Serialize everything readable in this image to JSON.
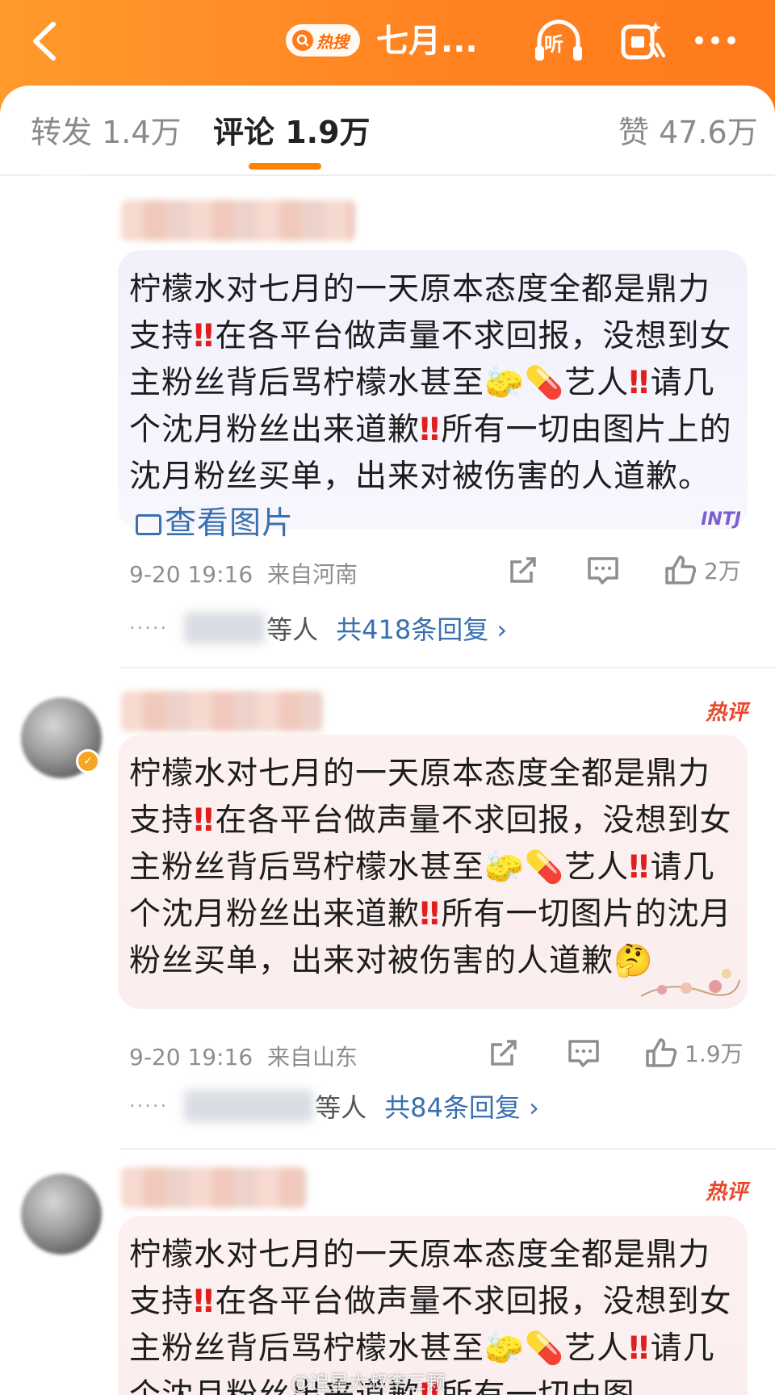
{
  "header": {
    "hot_badge": "热搜",
    "title": "七月...",
    "listen_label": "听"
  },
  "tabs": [
    {
      "label": "转发 1.4万"
    },
    {
      "label": "评论 1.9万"
    },
    {
      "label": "赞 47.6万"
    }
  ],
  "comments": [
    {
      "text_a": "柠檬水对七月的一天原本态度全都是鼎力支持",
      "text_b": "在各平台做声量不求回报，没想到女主粉丝背后骂柠檬水甚至🧽💊艺人",
      "text_c": "请几个沈月粉丝出来道歉",
      "text_d": "所有一切由图片上的沈月粉丝买单，出来对被伤害的人道歉。",
      "view_image": "查看图片",
      "bang": "‼",
      "deco": "INTJ",
      "time": "9-20 19:16",
      "location": "来自河南",
      "likes": "2万",
      "replies_suffix": "等人",
      "replies_count": "共418条回复 ›",
      "reply_dots": "·····"
    },
    {
      "hot_tag": "热评",
      "text_a": "柠檬水对七月的一天原本态度全都是鼎力支持",
      "text_b": "在各平台做声量不求回报，没想到女主粉丝背后骂柠檬水甚至🧽💊艺人",
      "text_c": "请几个沈月粉丝出来道歉",
      "text_d": "所有一切图片的沈月粉丝买单，出来对被伤害的人道歉🤔",
      "bang": "‼",
      "time": "9-20 19:16",
      "location": "来自山东",
      "likes": "1.9万",
      "replies_suffix": "等人",
      "replies_count": "共84条回复 ›",
      "reply_dots": "·····"
    },
    {
      "hot_tag": "热评",
      "text_a": "柠檬水对七月的一天原本态度全都是鼎力支持",
      "text_b": "在各平台做声量不求回报，没想到女主粉丝背后骂柠檬水甚至🧽💊艺人",
      "text_c": "请几个沈月粉丝出来道歉",
      "text_d": "所有一切由图",
      "bang": "‼"
    }
  ],
  "watermark": "@追星大叔李三颗",
  "colors": {
    "brand_orange": "#ff8220",
    "link_blue": "#3a6fb0",
    "hot_red": "#e8472a"
  }
}
